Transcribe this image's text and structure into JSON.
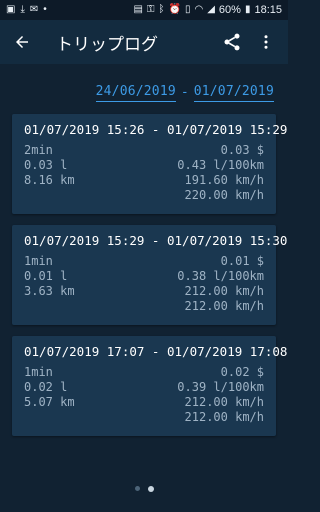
{
  "status": {
    "battery": "60%",
    "time": "18:15"
  },
  "appbar": {
    "title": "トリップログ"
  },
  "date_range": {
    "from": "24/06/2019",
    "separator": "-",
    "to": "01/07/2019"
  },
  "trips": [
    {
      "period": "01/07/2019 15:26 - 01/07/2019 15:29",
      "duration": "2min",
      "cost": "0.03 $",
      "fuel": "0.03 l",
      "consumption": "0.43 l/100km",
      "distance": "8.16 km",
      "avg_speed": "191.60 km/h",
      "max_speed": "220.00 km/h"
    },
    {
      "period": "01/07/2019 15:29 - 01/07/2019 15:30",
      "duration": "1min",
      "cost": "0.01 $",
      "fuel": "0.01 l",
      "consumption": "0.38 l/100km",
      "distance": "3.63 km",
      "avg_speed": "212.00 km/h",
      "max_speed": "212.00 km/h"
    },
    {
      "period": "01/07/2019 17:07 - 01/07/2019 17:08",
      "duration": "1min",
      "cost": "0.02 $",
      "fuel": "0.02 l",
      "consumption": "0.39 l/100km",
      "distance": "5.07 km",
      "avg_speed": "212.00 km/h",
      "max_speed": "212.00 km/h"
    }
  ],
  "pager": {
    "pages": 2,
    "active": 2
  }
}
